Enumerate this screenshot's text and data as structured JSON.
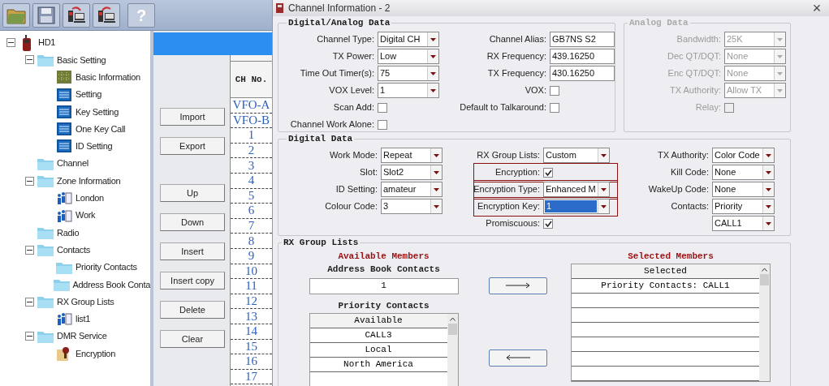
{
  "toolbar": [
    {
      "kind": "open"
    },
    {
      "kind": "save"
    },
    {
      "kind": "read"
    },
    {
      "kind": "write"
    },
    {
      "kind": "help",
      "glyph": "?"
    }
  ],
  "tree": [
    {
      "label": "HD1",
      "kind": "radio",
      "expanded": true,
      "children": [
        {
          "label": "Basic Setting",
          "kind": "folder",
          "expanded": true,
          "children": [
            {
              "label": "Basic Information",
              "kind": "grid"
            },
            {
              "label": "Setting",
              "kind": "set"
            },
            {
              "label": "Key Setting",
              "kind": "set"
            },
            {
              "label": "One Key Call",
              "kind": "set"
            },
            {
              "label": "ID Setting",
              "kind": "set"
            }
          ]
        },
        {
          "label": "Channel",
          "kind": "folder"
        },
        {
          "label": "Zone Information",
          "kind": "folder",
          "expanded": true,
          "children": [
            {
              "label": "London",
              "kind": "group"
            },
            {
              "label": "Work",
              "kind": "group"
            }
          ]
        },
        {
          "label": "Radio",
          "kind": "folder"
        },
        {
          "label": "Contacts",
          "kind": "folder",
          "expanded": true,
          "children": [
            {
              "label": "Priority Contacts",
              "kind": "folder"
            },
            {
              "label": "Address Book Conta",
              "kind": "folder"
            }
          ]
        },
        {
          "label": "RX Group Lists",
          "kind": "folder",
          "expanded": true,
          "children": [
            {
              "label": "list1",
              "kind": "group"
            }
          ]
        },
        {
          "label": "DMR Service",
          "kind": "folder",
          "expanded": true,
          "children": [
            {
              "label": "Encryption",
              "kind": "key"
            }
          ]
        }
      ]
    }
  ],
  "channel_buttons": [
    [
      "Import",
      "Export"
    ],
    [
      "Up",
      "Down",
      "Insert",
      "Insert copy",
      "Delete",
      "Clear"
    ]
  ],
  "channel_table": {
    "header": "CH No.",
    "rows": [
      "VFO-A",
      "VFO-B",
      "1",
      "2",
      "3",
      "4",
      "5",
      "6",
      "7",
      "8",
      "9",
      "10",
      "11",
      "12",
      "13",
      "14",
      "15",
      "16",
      "17"
    ]
  },
  "dialog": {
    "title": "Channel Information - 2",
    "close": "×",
    "digital_analog": {
      "title": "Digital/Analog Data",
      "left": [
        {
          "kind": "select",
          "label": "Channel Type:",
          "value": "Digital CH"
        },
        {
          "kind": "select",
          "label": "TX Power:",
          "value": "Low"
        },
        {
          "kind": "select",
          "label": "Time Out Timer(s):",
          "value": "75"
        },
        {
          "kind": "select",
          "label": "VOX Level:",
          "value": "1"
        },
        {
          "kind": "checkbox",
          "label": "Scan Add:",
          "checked": false
        },
        {
          "kind": "checkbox",
          "label": "Channel Work Alone:",
          "checked": false
        }
      ],
      "right": [
        {
          "kind": "input",
          "label": "Channel Alias:",
          "value": "GB7NS S2"
        },
        {
          "kind": "input",
          "label": "RX Frequency:",
          "value": "439.16250"
        },
        {
          "kind": "input",
          "label": "TX Frequency:",
          "value": "430.16250"
        },
        {
          "kind": "checkbox",
          "label": "VOX:",
          "checked": false
        },
        {
          "kind": "checkbox",
          "label": "Default to Talkaround:",
          "checked": false
        }
      ]
    },
    "analog": {
      "title": "Analog Data",
      "disabled": true,
      "fields": [
        {
          "kind": "select",
          "label": "Bandwidth:",
          "value": "25K"
        },
        {
          "kind": "select",
          "label": "Dec QT/DQT:",
          "value": "None"
        },
        {
          "kind": "select",
          "label": "Enc QT/DQT:",
          "value": "None"
        },
        {
          "kind": "select",
          "label": "TX Authority:",
          "value": "Allow TX"
        },
        {
          "kind": "checkbox",
          "label": "Relay:",
          "checked": false
        }
      ]
    },
    "digital": {
      "title": "Digital Data",
      "columns": [
        [
          {
            "kind": "select",
            "label": "Work Mode:",
            "value": "Repeat"
          },
          {
            "kind": "select",
            "label": "Slot:",
            "value": "Slot2"
          },
          {
            "kind": "select",
            "label": "ID Setting:",
            "value": "amateur"
          },
          {
            "kind": "select",
            "label": "Colour Code:",
            "value": "3"
          }
        ],
        [
          {
            "kind": "select",
            "label": "RX Group Lists:",
            "value": "Custom"
          },
          {
            "kind": "checkbox",
            "label": "Encryption:",
            "checked": true,
            "highlighted": true
          },
          {
            "kind": "select",
            "label": "Encryption Type:",
            "value": "Enhanced M",
            "highlighted": true
          },
          {
            "kind": "select",
            "label": "Encryption Key:",
            "value": "1",
            "focused": true,
            "highlighted": true
          },
          {
            "kind": "checkbox",
            "label": "Promiscuous:",
            "checked": true
          }
        ],
        [
          {
            "kind": "select",
            "label": "TX Authority:",
            "value": "Color Code"
          },
          {
            "kind": "select",
            "label": "Kill Code:",
            "value": "None"
          },
          {
            "kind": "select",
            "label": "WakeUp Code:",
            "value": "None"
          },
          {
            "kind": "select",
            "label": "Contacts:",
            "value": "Priority"
          },
          {
            "kind": "select",
            "value": "CALL1"
          }
        ]
      ]
    },
    "rx_group_lists": {
      "title": "RX Group Lists",
      "available_title": "Available Members",
      "address_book_title": "Address Book Contacts",
      "address_book_value": "1",
      "priority_title": "Priority Contacts",
      "available_table": {
        "header": "Available",
        "rows": [
          "CALL3",
          "Local",
          "North America"
        ]
      },
      "selected_title": "Selected Members",
      "selected_table": {
        "header": "Selected",
        "rows": [
          "Priority Contacts: CALL1"
        ]
      }
    }
  }
}
